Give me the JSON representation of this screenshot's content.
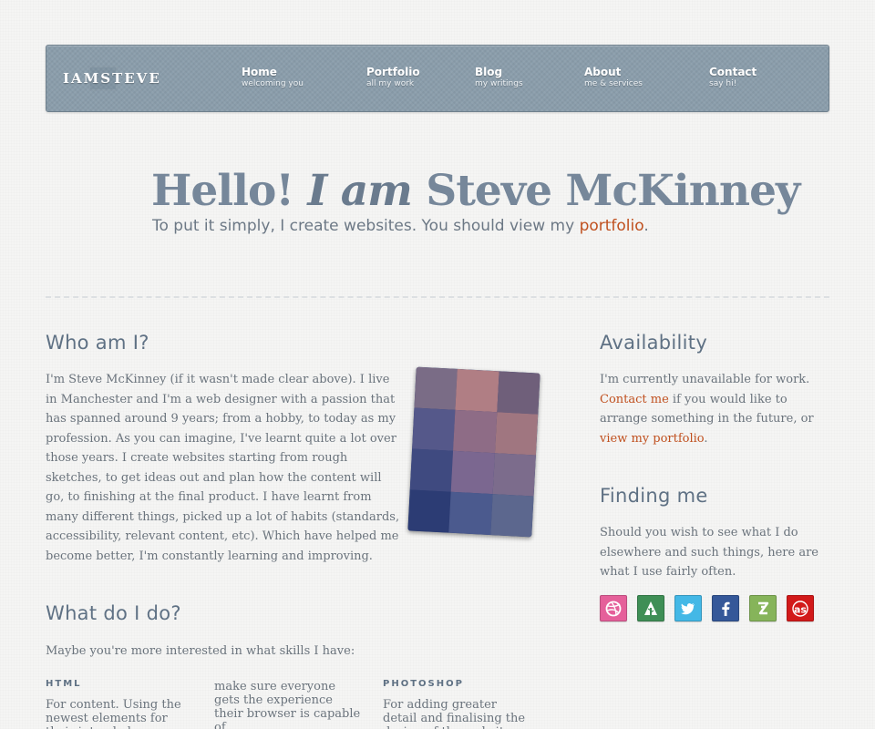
{
  "nav": {
    "logo": "IAMSTEVE",
    "items": [
      {
        "title": "Home",
        "sub": "welcoming you"
      },
      {
        "title": "Portfolio",
        "sub": "all my work"
      },
      {
        "title": "Blog",
        "sub": "my writings"
      },
      {
        "title": "About",
        "sub": "me & services"
      },
      {
        "title": "Contact",
        "sub": "say hi!"
      }
    ]
  },
  "hero": {
    "hello": "Hello! ",
    "iam": "I am",
    "name": " Steve McKinney",
    "sub_before": "To put it simply, I create websites. You should view my ",
    "sub_link": "portfolio",
    "sub_after": "."
  },
  "who": {
    "heading": "Who am I?",
    "body": "I'm Steve McKinney (if it wasn't made clear above). I live in Manchester and I'm a web designer with a passion that has spanned around 9 years; from a hobby, to today as my profession. As you can imagine, I've learnt quite a lot over those years. I create websites starting from rough sketches, to get ideas out and plan how the content will go, to finishing at the final product. I have learnt from many different things, picked up a lot of habits (standards, accessibility, relevant content, etc). Which have helped me become better, I'm constantly learning and improving."
  },
  "what": {
    "heading": "What do I do?",
    "intro": "Maybe you're more interested in what skills I have:",
    "skills": [
      {
        "label": "HTML",
        "text": "For content. Using the newest elements for their intended purposes."
      },
      {
        "label": "",
        "text": "make sure everyone gets the experience their browser is capable of."
      },
      {
        "label": "PHOTOSHOP",
        "text": "For adding greater detail and finalising the design of the website."
      }
    ]
  },
  "availability": {
    "heading": "Availability",
    "line1": "I'm currently unavailable for work.",
    "contact_link": "Contact me",
    "middle": " if you would like to arrange something in the future, or ",
    "portfolio_link": "view my portfolio",
    "end": "."
  },
  "finding": {
    "heading": "Finding me",
    "body": "Should you wish to see what I do elsewhere and such things, here are what I use fairly often.",
    "icons": [
      {
        "name": "dribbble-icon",
        "color": "#e5609a"
      },
      {
        "name": "forrst-icon",
        "color": "#3f8f56"
      },
      {
        "name": "twitter-icon",
        "color": "#44b8e6"
      },
      {
        "name": "facebook-icon",
        "color": "#355899"
      },
      {
        "name": "zerply-icon",
        "color": "#86b45a"
      },
      {
        "name": "lastfm-icon",
        "color": "#d21a1a"
      }
    ]
  }
}
